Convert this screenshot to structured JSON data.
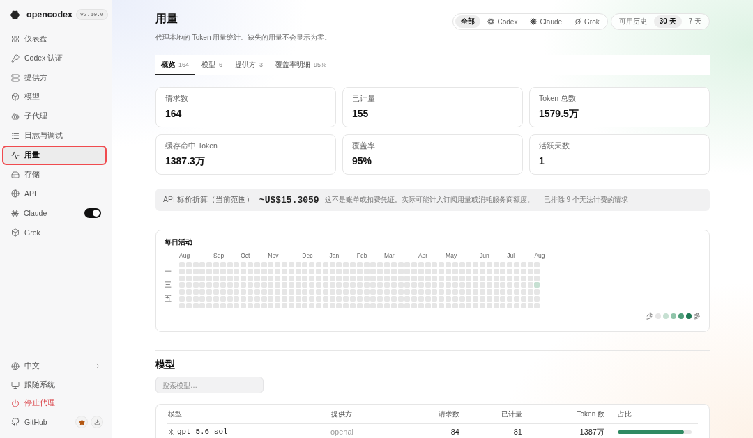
{
  "app": {
    "name": "opencodex",
    "version": "v2.10.0"
  },
  "sidebar": {
    "items": [
      {
        "label": "仪表盘",
        "kind": "link",
        "selected": false
      },
      {
        "label": "Codex 认证",
        "kind": "link",
        "selected": false
      },
      {
        "label": "提供方",
        "kind": "link",
        "selected": false
      },
      {
        "label": "模型",
        "kind": "link",
        "selected": false
      },
      {
        "label": "子代理",
        "kind": "link",
        "selected": false
      },
      {
        "label": "日志与调试",
        "kind": "link",
        "selected": false
      },
      {
        "label": "用量",
        "kind": "link",
        "selected": true
      },
      {
        "label": "存储",
        "kind": "link",
        "selected": false
      },
      {
        "label": "API",
        "kind": "link",
        "selected": false
      },
      {
        "label": "Claude",
        "kind": "toggle",
        "selected": false,
        "on": true
      },
      {
        "label": "Grok",
        "kind": "link",
        "selected": false
      }
    ],
    "footer": {
      "language": {
        "label": "中文"
      },
      "theme": {
        "label": "跟随系统"
      },
      "stop_proxy": {
        "label": "停止代理"
      },
      "github": {
        "label": "GitHub"
      }
    }
  },
  "page": {
    "title": "用量",
    "subtitle": "代理本地的 Token 用量统计。缺失的用量不会显示为零。"
  },
  "provider_filter": [
    {
      "label": "全部",
      "selected": true
    },
    {
      "label": "Codex",
      "selected": false
    },
    {
      "label": "Claude",
      "selected": false
    },
    {
      "label": "Grok",
      "selected": false
    }
  ],
  "range_filter": [
    {
      "label": "可用历史",
      "selected": false
    },
    {
      "label": "30 天",
      "selected": true
    },
    {
      "label": "7 天",
      "selected": false
    }
  ],
  "tabs": [
    {
      "label": "概览",
      "count": "164",
      "selected": true
    },
    {
      "label": "模型",
      "count": "6",
      "selected": false
    },
    {
      "label": "提供方",
      "count": "3",
      "selected": false
    },
    {
      "label": "覆盖率明细",
      "count": "95%",
      "selected": false
    }
  ],
  "stats": [
    {
      "label": "请求数",
      "value": "164"
    },
    {
      "label": "已计量",
      "value": "155"
    },
    {
      "label": "Token 总数",
      "value": "1579.5万"
    },
    {
      "label": "缓存命中 Token",
      "value": "1387.3万"
    },
    {
      "label": "覆盖率",
      "value": "95%"
    },
    {
      "label": "活跃天数",
      "value": "1"
    }
  ],
  "cost": {
    "label": "API 标价折算（当前范围）",
    "value": "~US$15.3059",
    "note": "这不是账单或扣费凭证。实际可能计入订阅用量或消耗服务商额度。",
    "excluded": "已排除 9 个无法计费的请求"
  },
  "daily_activity": {
    "title": "每日活动",
    "weekday_labels": [
      "一",
      "三",
      "五"
    ],
    "weeks": [
      {
        "month": "Aug",
        "days": [
          {
            "color": "#e6e6e6"
          },
          {
            "color": "#e6e6e6"
          },
          {
            "color": "#e6e6e6"
          },
          {
            "color": "#e6e6e6"
          },
          {
            "color": "#e6e6e6"
          },
          {
            "color": "#e6e6e6"
          },
          {
            "color": "#e6e6e6"
          }
        ]
      },
      {
        "days": [
          {
            "color": "#e6e6e6"
          },
          {
            "color": "#e6e6e6"
          },
          {
            "color": "#e6e6e6"
          },
          {
            "color": "#e6e6e6"
          },
          {
            "color": "#e6e6e6"
          },
          {
            "color": "#e6e6e6"
          },
          {
            "color": "#e6e6e6"
          }
        ]
      },
      {
        "days": [
          {
            "color": "#e6e6e6"
          },
          {
            "color": "#e6e6e6"
          },
          {
            "color": "#e6e6e6"
          },
          {
            "color": "#e6e6e6"
          },
          {
            "color": "#e6e6e6"
          },
          {
            "color": "#e6e6e6"
          },
          {
            "color": "#e6e6e6"
          }
        ]
      },
      {
        "days": [
          {
            "color": "#e6e6e6"
          },
          {
            "color": "#e6e6e6"
          },
          {
            "color": "#e6e6e6"
          },
          {
            "color": "#e6e6e6"
          },
          {
            "color": "#e6e6e6"
          },
          {
            "color": "#e6e6e6"
          },
          {
            "color": "#e6e6e6"
          }
        ]
      },
      {
        "days": [
          {
            "color": "#e6e6e6"
          },
          {
            "color": "#e6e6e6"
          },
          {
            "color": "#e6e6e6"
          },
          {
            "color": "#e6e6e6"
          },
          {
            "color": "#e6e6e6"
          },
          {
            "color": "#e6e6e6"
          },
          {
            "color": "#e6e6e6"
          }
        ]
      },
      {
        "month": "Sep",
        "days": [
          {
            "color": "#e6e6e6"
          },
          {
            "color": "#e6e6e6"
          },
          {
            "color": "#e6e6e6"
          },
          {
            "color": "#e6e6e6"
          },
          {
            "color": "#e6e6e6"
          },
          {
            "color": "#e6e6e6"
          },
          {
            "color": "#e6e6e6"
          }
        ]
      },
      {
        "days": [
          {
            "color": "#e6e6e6"
          },
          {
            "color": "#e6e6e6"
          },
          {
            "color": "#e6e6e6"
          },
          {
            "color": "#e6e6e6"
          },
          {
            "color": "#e6e6e6"
          },
          {
            "color": "#e6e6e6"
          },
          {
            "color": "#e6e6e6"
          }
        ]
      },
      {
        "days": [
          {
            "color": "#e6e6e6"
          },
          {
            "color": "#e6e6e6"
          },
          {
            "color": "#e6e6e6"
          },
          {
            "color": "#e6e6e6"
          },
          {
            "color": "#e6e6e6"
          },
          {
            "color": "#e6e6e6"
          },
          {
            "color": "#e6e6e6"
          }
        ]
      },
      {
        "days": [
          {
            "color": "#e6e6e6"
          },
          {
            "color": "#e6e6e6"
          },
          {
            "color": "#e6e6e6"
          },
          {
            "color": "#e6e6e6"
          },
          {
            "color": "#e6e6e6"
          },
          {
            "color": "#e6e6e6"
          },
          {
            "color": "#e6e6e6"
          }
        ]
      },
      {
        "month": "Oct",
        "days": [
          {
            "color": "#e6e6e6"
          },
          {
            "color": "#e6e6e6"
          },
          {
            "color": "#e6e6e6"
          },
          {
            "color": "#e6e6e6"
          },
          {
            "color": "#e6e6e6"
          },
          {
            "color": "#e6e6e6"
          },
          {
            "color": "#e6e6e6"
          }
        ]
      },
      {
        "days": [
          {
            "color": "#e6e6e6"
          },
          {
            "color": "#e6e6e6"
          },
          {
            "color": "#e6e6e6"
          },
          {
            "color": "#e6e6e6"
          },
          {
            "color": "#e6e6e6"
          },
          {
            "color": "#e6e6e6"
          },
          {
            "color": "#e6e6e6"
          }
        ]
      },
      {
        "days": [
          {
            "color": "#e6e6e6"
          },
          {
            "color": "#e6e6e6"
          },
          {
            "color": "#e6e6e6"
          },
          {
            "color": "#e6e6e6"
          },
          {
            "color": "#e6e6e6"
          },
          {
            "color": "#e6e6e6"
          },
          {
            "color": "#e6e6e6"
          }
        ]
      },
      {
        "days": [
          {
            "color": "#e6e6e6"
          },
          {
            "color": "#e6e6e6"
          },
          {
            "color": "#e6e6e6"
          },
          {
            "color": "#e6e6e6"
          },
          {
            "color": "#e6e6e6"
          },
          {
            "color": "#e6e6e6"
          },
          {
            "color": "#e6e6e6"
          }
        ]
      },
      {
        "month": "Nov",
        "days": [
          {
            "color": "#e6e6e6"
          },
          {
            "color": "#e6e6e6"
          },
          {
            "color": "#e6e6e6"
          },
          {
            "color": "#e6e6e6"
          },
          {
            "color": "#e6e6e6"
          },
          {
            "color": "#e6e6e6"
          },
          {
            "color": "#e6e6e6"
          }
        ]
      },
      {
        "days": [
          {
            "color": "#e6e6e6"
          },
          {
            "color": "#e6e6e6"
          },
          {
            "color": "#e6e6e6"
          },
          {
            "color": "#e6e6e6"
          },
          {
            "color": "#e6e6e6"
          },
          {
            "color": "#e6e6e6"
          },
          {
            "color": "#e6e6e6"
          }
        ]
      },
      {
        "days": [
          {
            "color": "#e6e6e6"
          },
          {
            "color": "#e6e6e6"
          },
          {
            "color": "#e6e6e6"
          },
          {
            "color": "#e6e6e6"
          },
          {
            "color": "#e6e6e6"
          },
          {
            "color": "#e6e6e6"
          },
          {
            "color": "#e6e6e6"
          }
        ]
      },
      {
        "days": [
          {
            "color": "#e6e6e6"
          },
          {
            "color": "#e6e6e6"
          },
          {
            "color": "#e6e6e6"
          },
          {
            "color": "#e6e6e6"
          },
          {
            "color": "#e6e6e6"
          },
          {
            "color": "#e6e6e6"
          },
          {
            "color": "#e6e6e6"
          }
        ]
      },
      {
        "days": [
          {
            "color": "#e6e6e6"
          },
          {
            "color": "#e6e6e6"
          },
          {
            "color": "#e6e6e6"
          },
          {
            "color": "#e6e6e6"
          },
          {
            "color": "#e6e6e6"
          },
          {
            "color": "#e6e6e6"
          },
          {
            "color": "#e6e6e6"
          }
        ]
      },
      {
        "month": "Dec",
        "days": [
          {
            "color": "#e6e6e6"
          },
          {
            "color": "#e6e6e6"
          },
          {
            "color": "#e6e6e6"
          },
          {
            "color": "#e6e6e6"
          },
          {
            "color": "#e6e6e6"
          },
          {
            "color": "#e6e6e6"
          },
          {
            "color": "#e6e6e6"
          }
        ]
      },
      {
        "days": [
          {
            "color": "#e6e6e6"
          },
          {
            "color": "#e6e6e6"
          },
          {
            "color": "#e6e6e6"
          },
          {
            "color": "#e6e6e6"
          },
          {
            "color": "#e6e6e6"
          },
          {
            "color": "#e6e6e6"
          },
          {
            "color": "#e6e6e6"
          }
        ]
      },
      {
        "days": [
          {
            "color": "#e6e6e6"
          },
          {
            "color": "#e6e6e6"
          },
          {
            "color": "#e6e6e6"
          },
          {
            "color": "#e6e6e6"
          },
          {
            "color": "#e6e6e6"
          },
          {
            "color": "#e6e6e6"
          },
          {
            "color": "#e6e6e6"
          }
        ]
      },
      {
        "days": [
          {
            "color": "#e6e6e6"
          },
          {
            "color": "#e6e6e6"
          },
          {
            "color": "#e6e6e6"
          },
          {
            "color": "#e6e6e6"
          },
          {
            "color": "#e6e6e6"
          },
          {
            "color": "#e6e6e6"
          },
          {
            "color": "#e6e6e6"
          }
        ]
      },
      {
        "month": "Jan",
        "days": [
          {
            "color": "#e6e6e6"
          },
          {
            "color": "#e6e6e6"
          },
          {
            "color": "#e6e6e6"
          },
          {
            "color": "#e6e6e6"
          },
          {
            "color": "#e6e6e6"
          },
          {
            "color": "#e6e6e6"
          },
          {
            "color": "#e6e6e6"
          }
        ]
      },
      {
        "days": [
          {
            "color": "#e6e6e6"
          },
          {
            "color": "#e6e6e6"
          },
          {
            "color": "#e6e6e6"
          },
          {
            "color": "#e6e6e6"
          },
          {
            "color": "#e6e6e6"
          },
          {
            "color": "#e6e6e6"
          },
          {
            "color": "#e6e6e6"
          }
        ]
      },
      {
        "days": [
          {
            "color": "#e6e6e6"
          },
          {
            "color": "#e6e6e6"
          },
          {
            "color": "#e6e6e6"
          },
          {
            "color": "#e6e6e6"
          },
          {
            "color": "#e6e6e6"
          },
          {
            "color": "#e6e6e6"
          },
          {
            "color": "#e6e6e6"
          }
        ]
      },
      {
        "days": [
          {
            "color": "#e6e6e6"
          },
          {
            "color": "#e6e6e6"
          },
          {
            "color": "#e6e6e6"
          },
          {
            "color": "#e6e6e6"
          },
          {
            "color": "#e6e6e6"
          },
          {
            "color": "#e6e6e6"
          },
          {
            "color": "#e6e6e6"
          }
        ]
      },
      {
        "month": "Feb",
        "days": [
          {
            "color": "#e6e6e6"
          },
          {
            "color": "#e6e6e6"
          },
          {
            "color": "#e6e6e6"
          },
          {
            "color": "#e6e6e6"
          },
          {
            "color": "#e6e6e6"
          },
          {
            "color": "#e6e6e6"
          },
          {
            "color": "#e6e6e6"
          }
        ]
      },
      {
        "days": [
          {
            "color": "#e6e6e6"
          },
          {
            "color": "#e6e6e6"
          },
          {
            "color": "#e6e6e6"
          },
          {
            "color": "#e6e6e6"
          },
          {
            "color": "#e6e6e6"
          },
          {
            "color": "#e6e6e6"
          },
          {
            "color": "#e6e6e6"
          }
        ]
      },
      {
        "days": [
          {
            "color": "#e6e6e6"
          },
          {
            "color": "#e6e6e6"
          },
          {
            "color": "#e6e6e6"
          },
          {
            "color": "#e6e6e6"
          },
          {
            "color": "#e6e6e6"
          },
          {
            "color": "#e6e6e6"
          },
          {
            "color": "#e6e6e6"
          }
        ]
      },
      {
        "days": [
          {
            "color": "#e6e6e6"
          },
          {
            "color": "#e6e6e6"
          },
          {
            "color": "#e6e6e6"
          },
          {
            "color": "#e6e6e6"
          },
          {
            "color": "#e6e6e6"
          },
          {
            "color": "#e6e6e6"
          },
          {
            "color": "#e6e6e6"
          }
        ]
      },
      {
        "month": "Mar",
        "days": [
          {
            "color": "#e6e6e6"
          },
          {
            "color": "#e6e6e6"
          },
          {
            "color": "#e6e6e6"
          },
          {
            "color": "#e6e6e6"
          },
          {
            "color": "#e6e6e6"
          },
          {
            "color": "#e6e6e6"
          },
          {
            "color": "#e6e6e6"
          }
        ]
      },
      {
        "days": [
          {
            "color": "#e6e6e6"
          },
          {
            "color": "#e6e6e6"
          },
          {
            "color": "#e6e6e6"
          },
          {
            "color": "#e6e6e6"
          },
          {
            "color": "#e6e6e6"
          },
          {
            "color": "#e6e6e6"
          },
          {
            "color": "#e6e6e6"
          }
        ]
      },
      {
        "days": [
          {
            "color": "#e6e6e6"
          },
          {
            "color": "#e6e6e6"
          },
          {
            "color": "#e6e6e6"
          },
          {
            "color": "#e6e6e6"
          },
          {
            "color": "#e6e6e6"
          },
          {
            "color": "#e6e6e6"
          },
          {
            "color": "#e6e6e6"
          }
        ]
      },
      {
        "days": [
          {
            "color": "#e6e6e6"
          },
          {
            "color": "#e6e6e6"
          },
          {
            "color": "#e6e6e6"
          },
          {
            "color": "#e6e6e6"
          },
          {
            "color": "#e6e6e6"
          },
          {
            "color": "#e6e6e6"
          },
          {
            "color": "#e6e6e6"
          }
        ]
      },
      {
        "days": [
          {
            "color": "#e6e6e6"
          },
          {
            "color": "#e6e6e6"
          },
          {
            "color": "#e6e6e6"
          },
          {
            "color": "#e6e6e6"
          },
          {
            "color": "#e6e6e6"
          },
          {
            "color": "#e6e6e6"
          },
          {
            "color": "#e6e6e6"
          }
        ]
      },
      {
        "month": "Apr",
        "days": [
          {
            "color": "#e6e6e6"
          },
          {
            "color": "#e6e6e6"
          },
          {
            "color": "#e6e6e6"
          },
          {
            "color": "#e6e6e6"
          },
          {
            "color": "#e6e6e6"
          },
          {
            "color": "#e6e6e6"
          },
          {
            "color": "#e6e6e6"
          }
        ]
      },
      {
        "days": [
          {
            "color": "#e6e6e6"
          },
          {
            "color": "#e6e6e6"
          },
          {
            "color": "#e6e6e6"
          },
          {
            "color": "#e6e6e6"
          },
          {
            "color": "#e6e6e6"
          },
          {
            "color": "#e6e6e6"
          },
          {
            "color": "#e6e6e6"
          }
        ]
      },
      {
        "days": [
          {
            "color": "#e6e6e6"
          },
          {
            "color": "#e6e6e6"
          },
          {
            "color": "#e6e6e6"
          },
          {
            "color": "#e6e6e6"
          },
          {
            "color": "#e6e6e6"
          },
          {
            "color": "#e6e6e6"
          },
          {
            "color": "#e6e6e6"
          }
        ]
      },
      {
        "days": [
          {
            "color": "#e6e6e6"
          },
          {
            "color": "#e6e6e6"
          },
          {
            "color": "#e6e6e6"
          },
          {
            "color": "#e6e6e6"
          },
          {
            "color": "#e6e6e6"
          },
          {
            "color": "#e6e6e6"
          },
          {
            "color": "#e6e6e6"
          }
        ]
      },
      {
        "month": "May",
        "days": [
          {
            "color": "#e6e6e6"
          },
          {
            "color": "#e6e6e6"
          },
          {
            "color": "#e6e6e6"
          },
          {
            "color": "#e6e6e6"
          },
          {
            "color": "#e6e6e6"
          },
          {
            "color": "#e6e6e6"
          },
          {
            "color": "#e6e6e6"
          }
        ]
      },
      {
        "days": [
          {
            "color": "#e6e6e6"
          },
          {
            "color": "#e6e6e6"
          },
          {
            "color": "#e6e6e6"
          },
          {
            "color": "#e6e6e6"
          },
          {
            "color": "#e6e6e6"
          },
          {
            "color": "#e6e6e6"
          },
          {
            "color": "#e6e6e6"
          }
        ]
      },
      {
        "days": [
          {
            "color": "#e6e6e6"
          },
          {
            "color": "#e6e6e6"
          },
          {
            "color": "#e6e6e6"
          },
          {
            "color": "#e6e6e6"
          },
          {
            "color": "#e6e6e6"
          },
          {
            "color": "#e6e6e6"
          },
          {
            "color": "#e6e6e6"
          }
        ]
      },
      {
        "days": [
          {
            "color": "#e6e6e6"
          },
          {
            "color": "#e6e6e6"
          },
          {
            "color": "#e6e6e6"
          },
          {
            "color": "#e6e6e6"
          },
          {
            "color": "#e6e6e6"
          },
          {
            "color": "#e6e6e6"
          },
          {
            "color": "#e6e6e6"
          }
        ]
      },
      {
        "days": [
          {
            "color": "#e6e6e6"
          },
          {
            "color": "#e6e6e6"
          },
          {
            "color": "#e6e6e6"
          },
          {
            "color": "#e6e6e6"
          },
          {
            "color": "#e6e6e6"
          },
          {
            "color": "#e6e6e6"
          },
          {
            "color": "#e6e6e6"
          }
        ]
      },
      {
        "month": "Jun",
        "days": [
          {
            "color": "#e6e6e6"
          },
          {
            "color": "#e6e6e6"
          },
          {
            "color": "#e6e6e6"
          },
          {
            "color": "#e6e6e6"
          },
          {
            "color": "#e6e6e6"
          },
          {
            "color": "#e6e6e6"
          },
          {
            "color": "#e6e6e6"
          }
        ]
      },
      {
        "days": [
          {
            "color": "#e6e6e6"
          },
          {
            "color": "#e6e6e6"
          },
          {
            "color": "#e6e6e6"
          },
          {
            "color": "#e6e6e6"
          },
          {
            "color": "#e6e6e6"
          },
          {
            "color": "#e6e6e6"
          },
          {
            "color": "#e6e6e6"
          }
        ]
      },
      {
        "days": [
          {
            "color": "#e6e6e6"
          },
          {
            "color": "#e6e6e6"
          },
          {
            "color": "#e6e6e6"
          },
          {
            "color": "#e6e6e6"
          },
          {
            "color": "#e6e6e6"
          },
          {
            "color": "#e6e6e6"
          },
          {
            "color": "#e6e6e6"
          }
        ]
      },
      {
        "days": [
          {
            "color": "#e6e6e6"
          },
          {
            "color": "#e6e6e6"
          },
          {
            "color": "#e6e6e6"
          },
          {
            "color": "#e6e6e6"
          },
          {
            "color": "#e6e6e6"
          },
          {
            "color": "#e6e6e6"
          },
          {
            "color": "#e6e6e6"
          }
        ]
      },
      {
        "month": "Jul",
        "days": [
          {
            "color": "#e6e6e6"
          },
          {
            "color": "#e6e6e6"
          },
          {
            "color": "#e6e6e6"
          },
          {
            "color": "#e6e6e6"
          },
          {
            "color": "#e6e6e6"
          },
          {
            "color": "#e6e6e6"
          },
          {
            "color": "#e6e6e6"
          }
        ]
      },
      {
        "days": [
          {
            "color": "#e6e6e6"
          },
          {
            "color": "#e6e6e6"
          },
          {
            "color": "#e6e6e6"
          },
          {
            "color": "#e6e6e6"
          },
          {
            "color": "#e6e6e6"
          },
          {
            "color": "#e6e6e6"
          },
          {
            "color": "#e6e6e6"
          }
        ]
      },
      {
        "days": [
          {
            "color": "#e6e6e6"
          },
          {
            "color": "#e6e6e6"
          },
          {
            "color": "#e6e6e6"
          },
          {
            "color": "#e6e6e6"
          },
          {
            "color": "#e6e6e6"
          },
          {
            "color": "#e6e6e6"
          },
          {
            "color": "#e6e6e6"
          }
        ]
      },
      {
        "days": [
          {
            "color": "#e6e6e6"
          },
          {
            "color": "#e6e6e6"
          },
          {
            "color": "#e6e6e6"
          },
          {
            "color": "#e6e6e6"
          },
          {
            "color": "#e6e6e6"
          },
          {
            "color": "#e6e6e6"
          },
          {
            "color": "#e6e6e6"
          }
        ]
      },
      {
        "month": "Aug",
        "days": [
          {
            "color": "#e6e6e6"
          },
          {
            "color": "#e6e6e6"
          },
          {
            "color": "#e6e6e6"
          },
          {
            "color": "#c6e0d2"
          },
          {
            "color": "#e6e6e6"
          },
          {
            "color": "#e6e6e6"
          },
          {
            "color": "#e6e6e6"
          }
        ]
      }
    ],
    "legend": {
      "low": "少",
      "high": "多",
      "swatches": [
        {
          "color": "#e6e6e6"
        },
        {
          "color": "#c6e0d2"
        },
        {
          "color": "#8fc4a9"
        },
        {
          "color": "#4f9e7a"
        },
        {
          "color": "#1f7a55"
        }
      ]
    }
  },
  "models": {
    "title": "模型",
    "search": {
      "placeholder": "搜索模型…"
    },
    "columns": [
      "模型",
      "提供方",
      "请求数",
      "已计量",
      "Token 数",
      "占比"
    ],
    "rows": [
      {
        "model": "gpt-5.6-sol",
        "provider": "openai",
        "requests": "84",
        "metered": "81",
        "tokens": "1387万",
        "level": 0.9
      }
    ]
  }
}
